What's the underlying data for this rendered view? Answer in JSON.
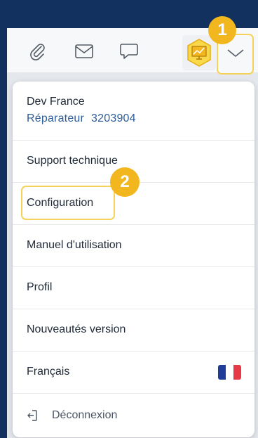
{
  "toolbar": {
    "icons": [
      "paperclip-icon",
      "mail-icon",
      "chat-icon",
      "monitor-chart-icon",
      "chevron-down-icon"
    ]
  },
  "badges": {
    "first": "1",
    "second": "2"
  },
  "user": {
    "name": "Dev France",
    "role": "Réparateur",
    "id": "3203904"
  },
  "menu": {
    "support": "Support technique",
    "configuration": "Configuration",
    "manual": "Manuel d'utilisation",
    "profile": "Profil",
    "news": "Nouveautés version",
    "language": "Français",
    "logout": "Déconnexion"
  },
  "colors": {
    "background": "#12315f",
    "accent_yellow": "#f2b71e",
    "highlight_outline": "#f5d35a",
    "role_text": "#2f5d99",
    "flag": [
      "#1f3c99",
      "#ffffff",
      "#e63946"
    ]
  }
}
